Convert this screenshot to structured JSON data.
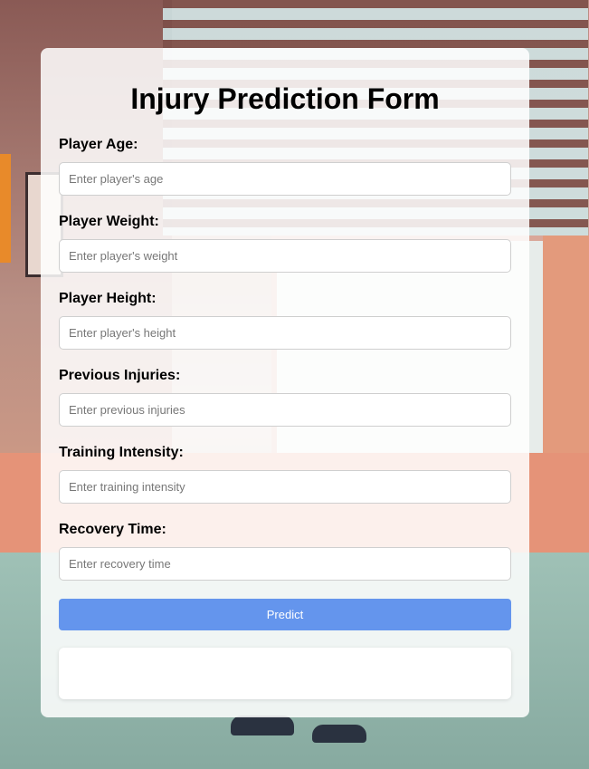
{
  "form": {
    "title": "Injury Prediction Form",
    "fields": [
      {
        "label": "Player Age:",
        "placeholder": "Enter player's age",
        "value": ""
      },
      {
        "label": "Player Weight:",
        "placeholder": "Enter player's weight",
        "value": ""
      },
      {
        "label": "Player Height:",
        "placeholder": "Enter player's height",
        "value": ""
      },
      {
        "label": "Previous Injuries:",
        "placeholder": "Enter previous injuries",
        "value": ""
      },
      {
        "label": "Training Intensity:",
        "placeholder": "Enter training intensity",
        "value": ""
      },
      {
        "label": "Recovery Time:",
        "placeholder": "Enter recovery time",
        "value": ""
      }
    ],
    "submit_label": "Predict",
    "result_text": ""
  },
  "colors": {
    "button": "#6495ed",
    "card": "#ffffff"
  }
}
